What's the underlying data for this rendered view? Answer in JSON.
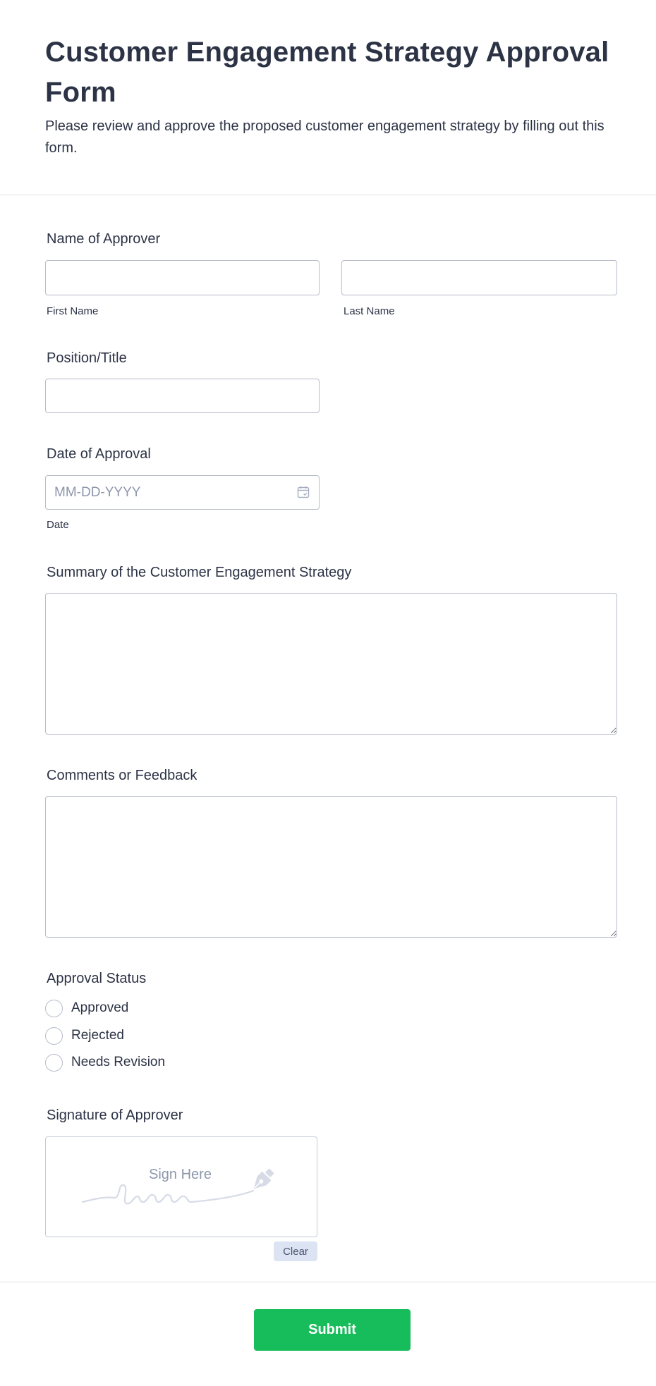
{
  "form": {
    "title": "Customer Engagement Strategy Approval Form",
    "description": "Please review and approve the proposed customer engagement strategy by filling out this form."
  },
  "approver_name": {
    "label": "Name of Approver",
    "first_value": "",
    "last_value": "",
    "first_sublabel": "First Name",
    "last_sublabel": "Last Name"
  },
  "position": {
    "label": "Position/Title",
    "value": ""
  },
  "approval_date": {
    "label": "Date of Approval",
    "placeholder": "MM-DD-YYYY",
    "sublabel": "Date",
    "icon": "calendar-icon"
  },
  "summary": {
    "label": "Summary of the Customer Engagement Strategy",
    "value": ""
  },
  "comments": {
    "label": "Comments or Feedback",
    "value": ""
  },
  "approval_status": {
    "label": "Approval Status",
    "options": [
      "Approved",
      "Rejected",
      "Needs Revision"
    ]
  },
  "signature": {
    "label": "Signature of Approver",
    "placeholder": "Sign Here",
    "clear_label": "Clear",
    "icon": "pen-nib-icon"
  },
  "submit": {
    "label": "Submit"
  },
  "colors": {
    "text": "#2c3345",
    "border": "#b8bdc9",
    "placeholder": "#8d97ad",
    "submit": "#18bd5b",
    "clear_bg": "#dce3f2"
  }
}
